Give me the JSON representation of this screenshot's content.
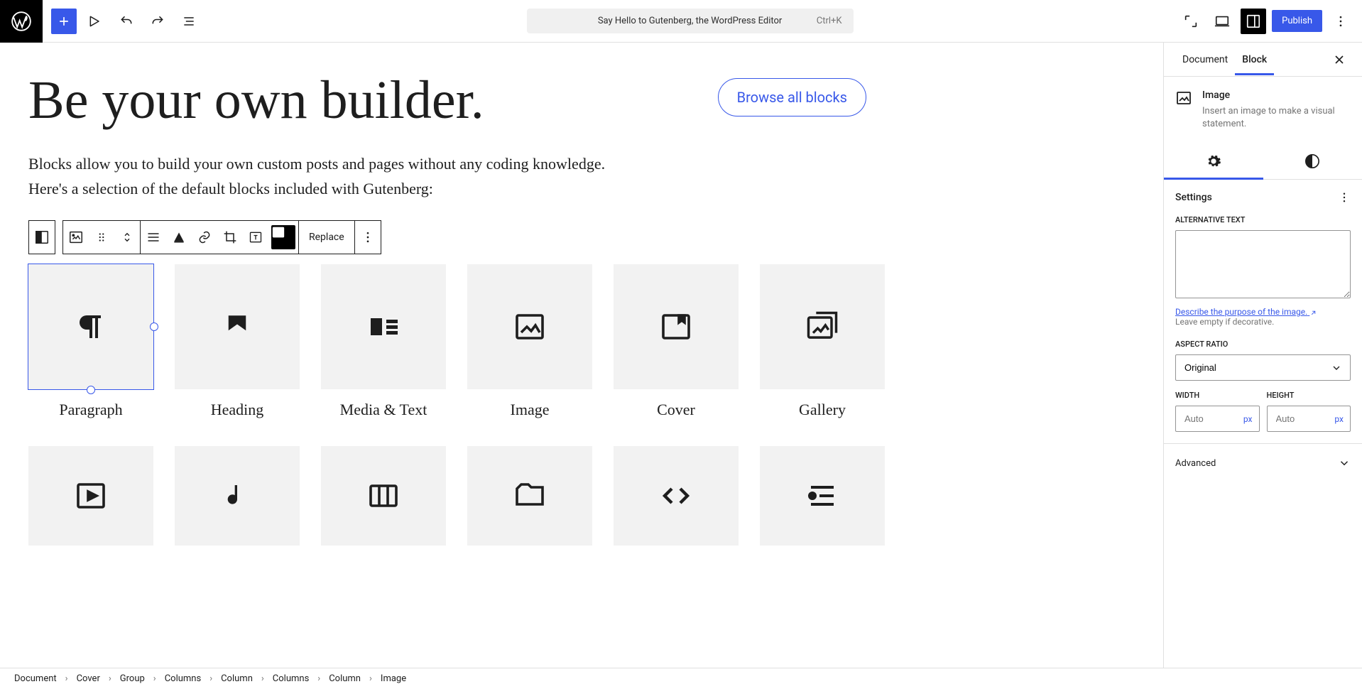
{
  "topbar": {
    "title": "Say Hello to Gutenberg, the WordPress Editor",
    "shortcut": "Ctrl+K",
    "publish": "Publish"
  },
  "canvas": {
    "heading": "Be your own builder.",
    "browse": "Browse all blocks",
    "p1": "Blocks allow you to build your own custom posts and pages without any coding knowledge.",
    "p2": "Here's a selection of the default blocks included with Gutenberg:",
    "replace": "Replace",
    "blocks_row1": [
      {
        "label": "Paragraph"
      },
      {
        "label": "Heading"
      },
      {
        "label": "Media & Text"
      },
      {
        "label": "Image"
      },
      {
        "label": "Cover"
      },
      {
        "label": "Gallery"
      }
    ]
  },
  "sidebar": {
    "tabs": {
      "document": "Document",
      "block": "Block"
    },
    "block": {
      "title": "Image",
      "desc": "Insert an image to make a visual statement."
    },
    "settings_title": "Settings",
    "alt_label": "Alternative Text",
    "alt_help_link": "Describe the purpose of the image.",
    "alt_help_rest": "Leave empty if decorative.",
    "aspect_label": "Aspect Ratio",
    "aspect_value": "Original",
    "width_label": "Width",
    "height_label": "Height",
    "dim_placeholder": "Auto",
    "dim_unit": "px",
    "advanced": "Advanced"
  },
  "footer": {
    "crumbs": [
      "Document",
      "Cover",
      "Group",
      "Columns",
      "Column",
      "Columns",
      "Column",
      "Image"
    ]
  }
}
